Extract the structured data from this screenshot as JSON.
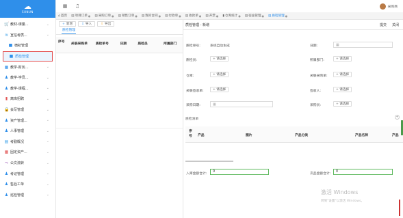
{
  "brand": {
    "name": "SUNUN",
    "icon": "cloud-icon"
  },
  "topbar": {
    "icons": [
      "grid-icon",
      "bell-icon"
    ],
    "user_name": "采购商"
  },
  "sidebar": {
    "items": [
      {
        "icon": "cart-icon",
        "label": "教材-课量...",
        "color": "#2f8fea",
        "sub": false,
        "chev": true
      },
      {
        "icon": "layers-icon",
        "label": "宣信考质...",
        "color": "#3aa0e8",
        "sub": false,
        "chev": true
      },
      {
        "icon": "box-icon",
        "label": "宿初管理",
        "color": "#2f8fea",
        "sub": true,
        "chev": false
      },
      {
        "icon": "box-icon",
        "label": "质检管理",
        "color": "#2f8fea",
        "sub": true,
        "chev": false,
        "active": true
      },
      {
        "icon": "grid-icon",
        "label": "教学-财务...",
        "color": "#2f8fea",
        "sub": false,
        "chev": true
      },
      {
        "icon": "person-icon",
        "label": "教学-学员...",
        "color": "#2f8fea",
        "sub": false,
        "chev": true
      },
      {
        "icon": "person-icon",
        "label": "教学-课程...",
        "color": "#2f8fea",
        "sub": false,
        "chev": true
      },
      {
        "icon": "chart-icon",
        "label": "离库招聘",
        "color": "#e25757",
        "sub": false,
        "chev": true
      },
      {
        "icon": "lock-icon",
        "label": "会写管理",
        "color": "#e25757",
        "sub": false,
        "chev": true
      },
      {
        "icon": "person-icon",
        "label": "资产管理...",
        "color": "#2f8fea",
        "sub": false,
        "chev": true
      },
      {
        "icon": "person-icon",
        "label": "人事管理",
        "color": "#2f8fea",
        "sub": false,
        "chev": true
      },
      {
        "icon": "doc-icon",
        "label": "考勤概况",
        "color": "#3aa0e8",
        "sub": false,
        "chev": true
      },
      {
        "icon": "grid-icon",
        "label": "固定资产...",
        "color": "#e25757",
        "sub": false,
        "chev": true
      },
      {
        "icon": "flow-icon",
        "label": "公文流转",
        "color": "#9b59b6",
        "sub": false,
        "chev": true
      },
      {
        "icon": "person-icon",
        "label": "考记管理",
        "color": "#2f8fea",
        "sub": false,
        "chev": true
      },
      {
        "icon": "person-icon",
        "label": "售后工单",
        "color": "#2f8fea",
        "sub": false,
        "chev": true
      },
      {
        "icon": "person-icon",
        "label": "巡检管理",
        "color": "#2f8fea",
        "sub": false,
        "chev": true
      }
    ]
  },
  "tabs": [
    {
      "label": "首页",
      "icon": "home-icon",
      "close": false,
      "active": false
    },
    {
      "label": "项目订单",
      "icon": "doc-icon",
      "close": true,
      "active": false
    },
    {
      "label": "采购订单",
      "icon": "doc-icon",
      "close": true,
      "active": false
    },
    {
      "label": "销售订单",
      "icon": "doc-icon",
      "close": true,
      "active": false
    },
    {
      "label": "我的合同",
      "icon": "doc-icon",
      "close": true,
      "active": false
    },
    {
      "label": "付款单",
      "icon": "doc-icon",
      "close": true,
      "active": false
    },
    {
      "label": "收款单",
      "icon": "doc-icon",
      "close": true,
      "active": false
    },
    {
      "label": "开票",
      "icon": "doc-icon",
      "close": true,
      "active": false
    },
    {
      "label": "仓库统计",
      "icon": "chart-icon",
      "close": true,
      "active": false
    },
    {
      "label": "宿舍管理",
      "icon": "doc-icon",
      "close": true,
      "active": false
    },
    {
      "label": "质检管理",
      "icon": "doc-icon",
      "close": true,
      "active": true
    }
  ],
  "list": {
    "toolbar": [
      {
        "icon": "+",
        "label": "新增",
        "kind": "g"
      },
      {
        "icon": "⇩",
        "label": "导入",
        "kind": "g"
      },
      {
        "icon": "⇧",
        "label": "导出",
        "kind": "o"
      }
    ],
    "subtab": "质检管理",
    "columns": [
      "序号",
      "关联采购单",
      "质检单号",
      "日期",
      "质检员",
      "所属部门"
    ]
  },
  "form": {
    "title": "质检管理 - 新增",
    "actions": [
      "提交",
      "关闭"
    ],
    "fields": {
      "doc_no_label": "质检单号:",
      "doc_no_value": "系统自动生成",
      "date_label": "日期:",
      "inspector_label": "质检员:",
      "dept_label": "所属部门:",
      "warehouse_label": "仓库:",
      "related_po_label": "关联采购单:",
      "related_recv_label": "关联签收单:",
      "receiver_label": "签收人:",
      "purchase_date_label": "采购日期:",
      "purchaser_label": "采购员:",
      "select_label": "+ 请选择"
    },
    "detail_title": "质检清单",
    "detail_columns": [
      "序号",
      "产品",
      "图片",
      "产品分类",
      "产品名称",
      "产品"
    ],
    "ok_qty_label": "入库金额合计:",
    "ok_qty_value": "0",
    "fail_qty_label": "次品金额合计:",
    "fail_qty_value": "0"
  },
  "watermark": {
    "title": "激活 Windows",
    "subtitle": "转到\"设置\"以激活 Windows。"
  }
}
